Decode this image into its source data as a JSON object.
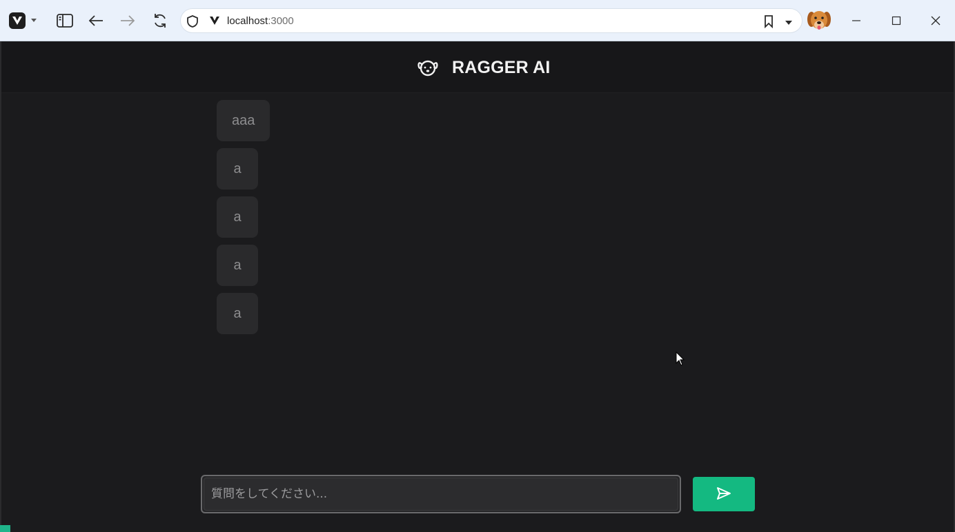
{
  "browser": {
    "url_host": "localhost",
    "url_port": ":3000",
    "icons": [
      "vivaldi-icon",
      "chevron-down-icon",
      "sidebar-toggle-icon",
      "back-icon",
      "forward-icon",
      "reload-icon",
      "shield-icon",
      "bookmark-icon",
      "dropdown-icon",
      "minimize-icon",
      "maximize-icon",
      "close-icon"
    ]
  },
  "app": {
    "title": "RAGGER AI",
    "logo_icon": "dog-face-icon",
    "accent_color": "#14b981",
    "background_color": "#1b1b1d"
  },
  "messages": [
    "aaa",
    "a",
    "a",
    "a",
    "a"
  ],
  "composer": {
    "placeholder": "質問をしてください...",
    "value": "",
    "send_icon": "send-icon"
  }
}
